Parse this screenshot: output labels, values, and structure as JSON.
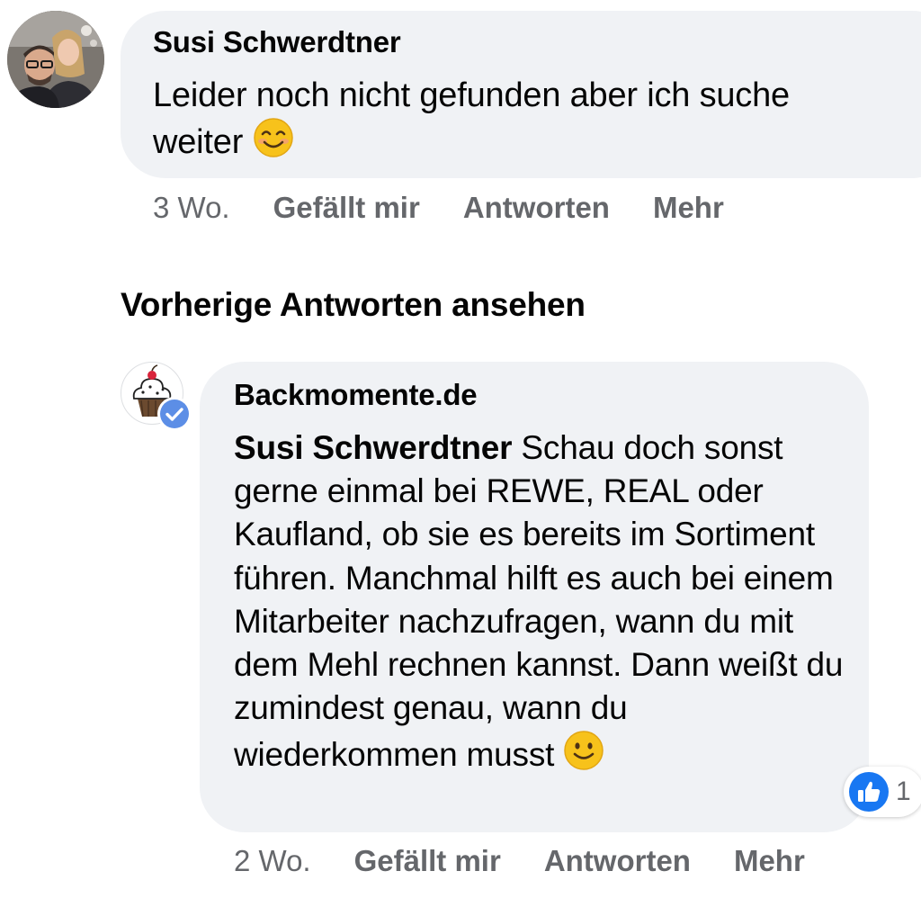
{
  "comment1": {
    "author": "Susi Schwerdtner",
    "text": "Leider noch nicht gefunden aber ich suche weiter",
    "emoji": "smiling-face-with-smiling-eyes",
    "time": "3 Wo.",
    "like_label": "Gefällt mir",
    "reply_label": "Antworten",
    "more_label": "Mehr"
  },
  "previous_replies_label": "Vorherige Antworten ansehen",
  "comment2": {
    "author": "Backmomente.de",
    "verified": true,
    "mention": "Susi Schwerdtner",
    "text": " Schau doch sonst gerne einmal bei REWE, REAL oder Kaufland, ob sie es bereits im Sortiment führen. Manchmal hilft es auch bei einem Mitarbeiter nachzufragen, wann du mit dem Mehl rechnen kannst. Dann weißt du zumindest genau, wann du wiederkommen musst",
    "emoji": "slightly-smiling-face",
    "reaction_icon": "thumbs-up-icon",
    "reaction_count": "1",
    "time": "2 Wo.",
    "like_label": "Gefällt mir",
    "reply_label": "Antworten",
    "more_label": "Mehr"
  },
  "colors": {
    "bubble": "#f0f2f5",
    "secondary_text": "#65676b",
    "like_blue": "#1877f2",
    "emoji_yellow": "#f7c21b"
  }
}
